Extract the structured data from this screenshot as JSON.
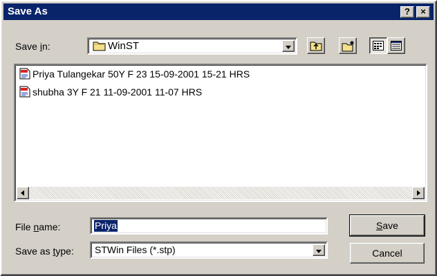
{
  "window": {
    "title": "Save As",
    "help_label": "?",
    "close_label": "×"
  },
  "save_in": {
    "label_before": "Save ",
    "label_accel": "i",
    "label_after": "n:",
    "folder": "WinST",
    "folder_icon": "folder-icon"
  },
  "toolbar": {
    "up_folder_icon": "up-folder-icon",
    "new_folder_icon": "new-folder-icon",
    "list_view_icon": "list-view-icon",
    "details_view_icon": "details-view-icon"
  },
  "files": [
    {
      "name": "Priya Tulangekar 50Y F 23 15-09-2001 15-21 HRS",
      "icon": "document-icon"
    },
    {
      "name": "shubha 3Y F 21 11-09-2001 11-07 HRS",
      "icon": "document-icon"
    }
  ],
  "file_name": {
    "label_before": "File ",
    "label_accel": "n",
    "label_after": "ame:",
    "value": "Priya"
  },
  "save_as_type": {
    "label_before": "Save as ",
    "label_accel": "t",
    "label_after": "ype:",
    "value": "STWin Files (*.stp)"
  },
  "buttons": {
    "save_accel": "S",
    "save_rest": "ave",
    "cancel": "Cancel"
  },
  "colors": {
    "titlebar": "#0a246a",
    "face": "#d4d0c8",
    "selection": "#0a246a"
  }
}
